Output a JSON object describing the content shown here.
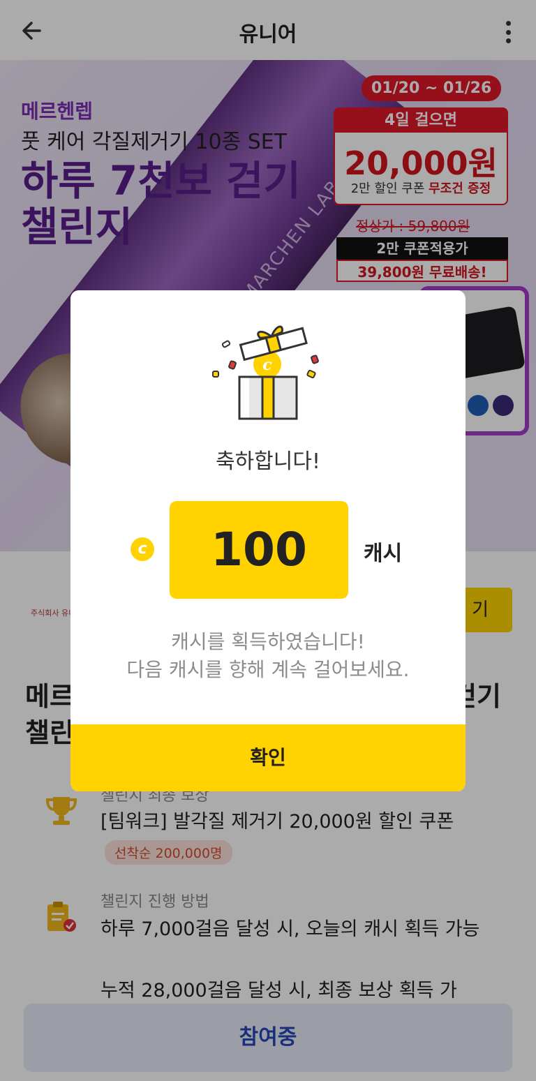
{
  "header": {
    "title": "유니어",
    "back_icon": "arrow-left-icon",
    "more_icon": "more-vertical-icon"
  },
  "banner": {
    "brand": "메르헨렙",
    "product": "풋 케어 각질제거기 10종 SET",
    "challenge_line1": "하루 7천보 걷기",
    "challenge_line2": "챌린지",
    "date_range": "01/20 ~ 01/26",
    "coupon_header": "4일 걸으면",
    "coupon_amount": "20,000원",
    "coupon_sub_prefix": "2만 할인 쿠폰",
    "coupon_sub_highlight": "무조건 증정",
    "regular_price": "정상가 : 59,800원",
    "coupon_price_label": "2만 쿠폰적용가",
    "final_price": "39,800원 무료배송!",
    "tube_label": "MARCHEN LAB."
  },
  "host": {
    "logo_text": "주식회사 유니",
    "button_label": "기"
  },
  "content": {
    "title_line1_left": "메르",
    "title_line1_right": "걷기",
    "title_line2": "챌린"
  },
  "info": {
    "reward_label": "챌린지 최종 보상",
    "reward_value": "[팀워크] 발각질 제거기 20,000원 할인 쿠폰",
    "reward_tag": "선착순 200,000명",
    "method_label": "챌린지 진행 방법",
    "method_value_1": "하루 7,000걸음 달성 시, 오늘의 캐시 획득 가능",
    "method_value_2": "누적 28,000걸음 달성 시, 최종 보상 획득 가"
  },
  "join_button": "참여중",
  "modal": {
    "congrats": "축하합니다!",
    "coin_glyph": "c",
    "amount": "100",
    "unit": "캐시",
    "message_line1": "캐시를 획득하였습니다!",
    "message_line2": "다음 캐시를 향해 계속 걸어보세요.",
    "confirm": "확인",
    "gift_coin_glyph": "c"
  },
  "colors": {
    "accent": "#ffd200",
    "banner_purple": "#5a1e8c",
    "coupon_red": "#e0182a",
    "join_text": "#2746b8"
  }
}
